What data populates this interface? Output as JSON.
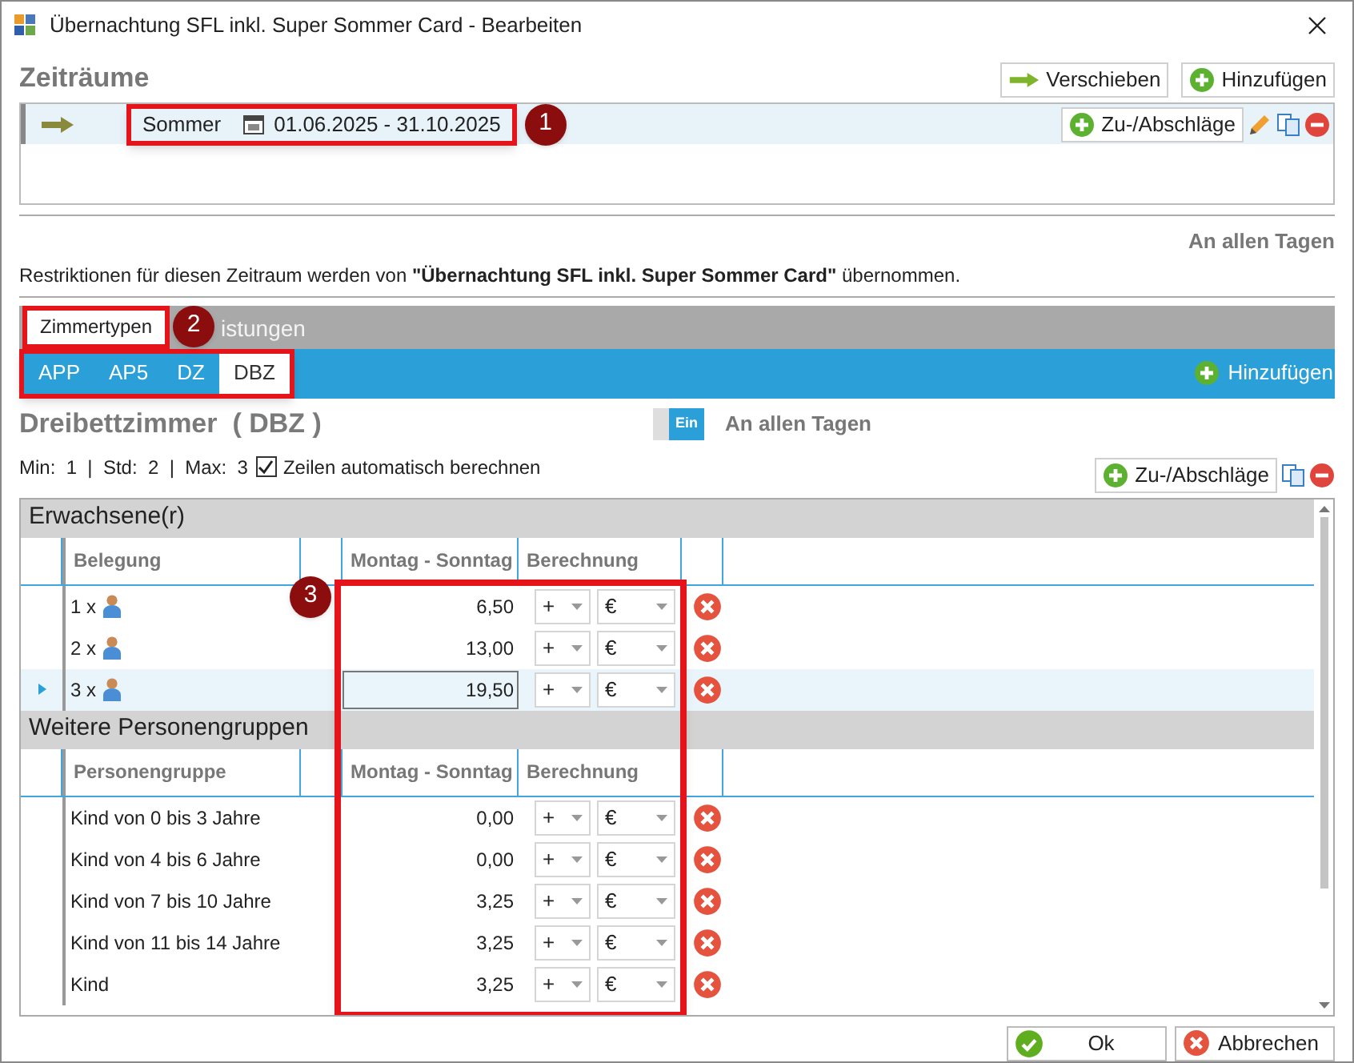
{
  "window": {
    "title": "Übernachtung SFL inkl. Super Sommer Card - Bearbeiten"
  },
  "periods_section": {
    "title": "Zeiträume",
    "buttons": [
      {
        "kind": "move",
        "label": "Verschieben"
      },
      {
        "kind": "add",
        "label": "Hinzufügen"
      }
    ],
    "periods": [
      {
        "name": "Sommer",
        "dates": "01.06.2025 - 31.10.2025",
        "callout": "1",
        "action": "Zu-/Abschläge"
      }
    ]
  },
  "days_label": "An allen Tagen",
  "restriction_note": "Restriktionen für diesen Zeitraum werden von **\"Übernachtung SFL inkl. Super Sommer Card\"** übernommen.",
  "tabs": [
    {
      "label": "Zimmertypen",
      "selected": true,
      "callout": "2"
    },
    {
      "label": "istungen",
      "selected": false
    }
  ],
  "room_types": [
    {
      "label": "APP",
      "selected": false
    },
    {
      "label": "AP5",
      "selected": false
    },
    {
      "label": "DZ",
      "selected": false
    },
    {
      "label": "DBZ",
      "selected": true
    }
  ],
  "room_add": "Hinzufügen",
  "room": {
    "title": "Dreibettzimmer  ( DBZ )",
    "toggle": {
      "label": "Ein",
      "on": true
    },
    "days_label": "An allen Tagen",
    "limits": "Min:  1  |  Std:  2  |  Max:  3",
    "auto_rows": {
      "label": "Zeilen automatisch berechnen",
      "checked": true
    },
    "action": "Zu-/Abschläge"
  },
  "sections": [
    {
      "title": "Erwachsene(r)",
      "columns": [
        "Belegung",
        "Montag - Sonntag",
        "Berechnung"
      ],
      "rows": [
        {
          "kind": "persons",
          "label": "1 x",
          "price": "6,50",
          "operator": "+",
          "unit": "€",
          "selected": false
        },
        {
          "kind": "persons",
          "label": "2 x",
          "price": "13,00",
          "operator": "+",
          "unit": "€",
          "selected": false
        },
        {
          "kind": "persons",
          "label": "3 x",
          "price": "19,50",
          "operator": "+",
          "unit": "€",
          "selected": true
        }
      ]
    },
    {
      "title": "Weitere Personengruppen",
      "columns": [
        "Personengruppe",
        "Montag - Sonntag",
        "Berechnung"
      ],
      "rows": [
        {
          "kind": "group",
          "label": "Kind von 0 bis 3 Jahre",
          "price": "0,00",
          "operator": "+",
          "unit": "€",
          "selected": false
        },
        {
          "kind": "group",
          "label": "Kind von 4 bis 6 Jahre",
          "price": "0,00",
          "operator": "+",
          "unit": "€",
          "selected": false
        },
        {
          "kind": "group",
          "label": "Kind von 7 bis 10 Jahre",
          "price": "3,25",
          "operator": "+",
          "unit": "€",
          "selected": false
        },
        {
          "kind": "group",
          "label": "Kind von 11 bis 14 Jahre",
          "price": "3,25",
          "operator": "+",
          "unit": "€",
          "selected": false
        },
        {
          "kind": "group",
          "label": "Kind",
          "price": "3,25",
          "operator": "+",
          "unit": "€",
          "selected": false
        }
      ]
    }
  ],
  "price_callout": "3",
  "buttons": [
    {
      "kind": "ok",
      "label": "Ok"
    },
    {
      "kind": "cancel",
      "label": "Abbrechen"
    }
  ]
}
